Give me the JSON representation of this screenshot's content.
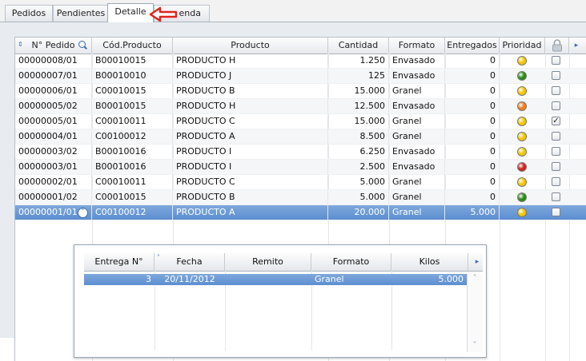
{
  "tabs": [
    "Pedidos",
    "Pendientes",
    "Detalle",
    "Agenda"
  ],
  "tabs_visible": [
    "Pedidos",
    "Pendientes",
    "Detalle",
    "enda"
  ],
  "active_tab": "Detalle",
  "grid": {
    "columns": [
      "N° Pedido",
      "Cód.Producto",
      "Producto",
      "Cantidad",
      "Formato",
      "Entregados",
      "Prioridad"
    ],
    "rows": [
      {
        "pedido": "00000008/01",
        "codigo": "B00010015",
        "producto": "PRODUCTO H",
        "cantidad": "1.250",
        "formato": "Envasado",
        "entregados": "0",
        "prioridad": "yellow",
        "checked": false
      },
      {
        "pedido": "00000007/01",
        "codigo": "B00010010",
        "producto": "PRODUCTO J",
        "cantidad": "125",
        "formato": "Envasado",
        "entregados": "0",
        "prioridad": "green",
        "checked": false
      },
      {
        "pedido": "00000006/01",
        "codigo": "C00010015",
        "producto": "PRODUCTO B",
        "cantidad": "15.000",
        "formato": "Granel",
        "entregados": "0",
        "prioridad": "yellow",
        "checked": false
      },
      {
        "pedido": "00000005/02",
        "codigo": "B00010015",
        "producto": "PRODUCTO H",
        "cantidad": "12.500",
        "formato": "Envasado",
        "entregados": "0",
        "prioridad": "orange",
        "checked": false
      },
      {
        "pedido": "00000005/01",
        "codigo": "C00010011",
        "producto": "PRODUCTO C",
        "cantidad": "15.000",
        "formato": "Granel",
        "entregados": "0",
        "prioridad": "yellow",
        "checked": true
      },
      {
        "pedido": "00000004/01",
        "codigo": "C00100012",
        "producto": "PRODUCTO A",
        "cantidad": "8.500",
        "formato": "Granel",
        "entregados": "0",
        "prioridad": "yellow",
        "checked": false
      },
      {
        "pedido": "00000003/02",
        "codigo": "B00010016",
        "producto": "PRODUCTO I",
        "cantidad": "6.250",
        "formato": "Envasado",
        "entregados": "0",
        "prioridad": "yellow",
        "checked": false
      },
      {
        "pedido": "00000003/01",
        "codigo": "B00010016",
        "producto": "PRODUCTO I",
        "cantidad": "2.500",
        "formato": "Envasado",
        "entregados": "0",
        "prioridad": "red",
        "checked": false
      },
      {
        "pedido": "00000002/01",
        "codigo": "C00010011",
        "producto": "PRODUCTO C",
        "cantidad": "5.000",
        "formato": "Granel",
        "entregados": "0",
        "prioridad": "yellow",
        "checked": false
      },
      {
        "pedido": "00000001/02",
        "codigo": "C00010015",
        "producto": "PRODUCTO B",
        "cantidad": "5.000",
        "formato": "Granel",
        "entregados": "0",
        "prioridad": "green",
        "checked": false
      },
      {
        "pedido": "00000001/01",
        "codigo": "C00100012",
        "producto": "PRODUCTO A",
        "cantidad": "20.000",
        "formato": "Granel",
        "entregados": "5.000",
        "prioridad": "yellow",
        "checked": false,
        "selected": true
      }
    ]
  },
  "detail": {
    "columns": [
      "Entrega N°",
      "Fecha",
      "Remito",
      "Formato",
      "Kilos"
    ],
    "rows": [
      {
        "entrega": "3",
        "fecha": "20/11/2012",
        "remito": "",
        "formato": "Granel",
        "kilos": "5.000"
      }
    ]
  },
  "colors": {
    "yellow": "#f5c500",
    "green": "#2a8a14",
    "orange": "#ef7f1a",
    "red": "#d0201a",
    "selection": "#5b8ed0",
    "arrow": "#e2231a"
  }
}
